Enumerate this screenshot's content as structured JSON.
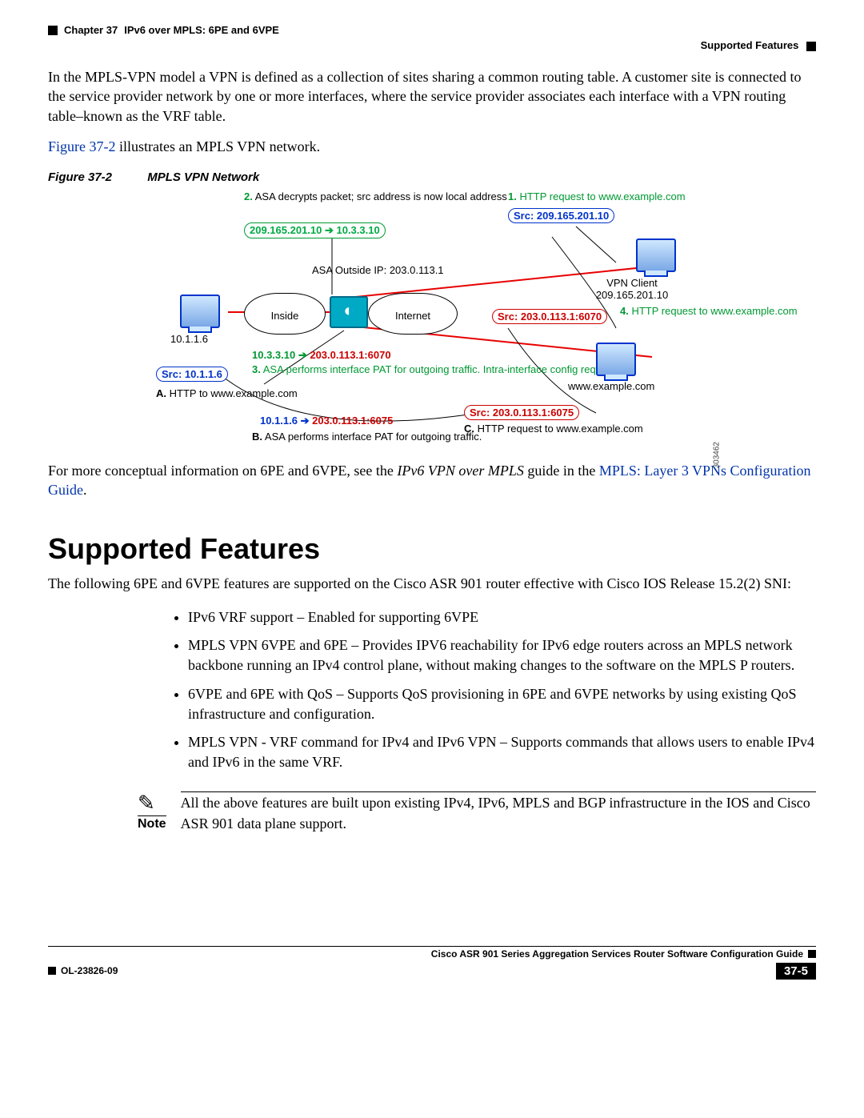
{
  "header": {
    "chapter": "Chapter 37",
    "title": "IPv6 over MPLS: 6PE and 6VPE",
    "subtitle": "Supported Features"
  },
  "intro": {
    "p1": "In the MPLS-VPN model a VPN is defined as a collection of sites sharing a common routing table. A customer site is connected to the service provider network by one or more interfaces, where the service provider associates each interface with a VPN routing table–known as the VRF table.",
    "p2a": "Figure 37-2",
    "p2b": " illustrates an MPLS VPN network."
  },
  "figure": {
    "label": "Figure 37-2",
    "title": "MPLS VPN Network",
    "note2_a": "2.",
    "note2_b": " ASA decrypts packet; src address is now local address",
    "note1_a": "1.",
    "note1_b": " HTTP request to www.example.com",
    "src_top_right": "Src: 209.165.201.10",
    "pill_green_top": "209.165.201.10  ➔  10.3.3.10",
    "asa_outside": "ASA Outside IP: 203.0.113.1",
    "cloud_inside": "Inside",
    "cloud_internet": "Internet",
    "vpn_client_a": "VPN Client",
    "vpn_client_b": "209.165.201.10",
    "ip_10116": "10.1.1.6",
    "pill_red_mid": "Src: 203.0.113.1:6070",
    "note4_a": "4.",
    "note4_b": " HTTP request to www.example.com",
    "mid_green_a": "10.3.3.10  ➔  ",
    "mid_red_b": "203.0.113.1:6070",
    "pill_blue_left": "Src: 10.1.1.6",
    "note3_a": "3.",
    "note3_b": " ASA performs interface PAT for outgoing traffic. Intra-interface config req'd.",
    "www_example": "www.example.com",
    "A_a": "A.",
    "A_b": " HTTP to www.example.com",
    "bot_blue": "10.1.1.6  ➔  ",
    "bot_red": "203.0.113.1:6075",
    "pill_red_bot": "Src: 203.0.113.1:6075",
    "C_a": "C.",
    "C_b": " HTTP request to www.example.com",
    "B_a": "B.",
    "B_b": " ASA performs interface PAT for outgoing traffic.",
    "img_id": "303462"
  },
  "after_fig": {
    "text_a": "For more conceptual information on 6PE and 6VPE, see the ",
    "text_i": "IPv6 VPN over MPLS",
    "text_b": " guide in the ",
    "link": "MPLS: Layer 3 VPNs Configuration Guide",
    "text_c": "."
  },
  "section_heading": "Supported Features",
  "features": {
    "intro": "The following 6PE and 6VPE features are supported on the Cisco ASR 901 router effective with Cisco IOS Release 15.2(2) SNI:",
    "b1": "IPv6 VRF support – Enabled for supporting 6VPE",
    "b2": "MPLS VPN 6VPE and 6PE – Provides IPV6 reachability for IPv6 edge routers across an MPLS network backbone running an IPv4 control plane, without making changes to the software on the MPLS P routers.",
    "b3": "6VPE and 6PE with QoS – Supports QoS provisioning in 6PE and 6VPE networks by using existing QoS infrastructure and configuration.",
    "b4": "MPLS VPN - VRF command for IPv4 and IPv6 VPN – Supports commands that allows users to enable IPv4 and IPv6 in the same VRF."
  },
  "note": {
    "label": "Note",
    "text": "All the above features are built upon existing IPv4, IPv6, MPLS and BGP infrastructure in the IOS and Cisco ASR 901 data plane support."
  },
  "footer": {
    "book": "Cisco ASR 901 Series Aggregation Services Router Software Configuration Guide",
    "docnum": "OL-23826-09",
    "page": "37-5"
  }
}
